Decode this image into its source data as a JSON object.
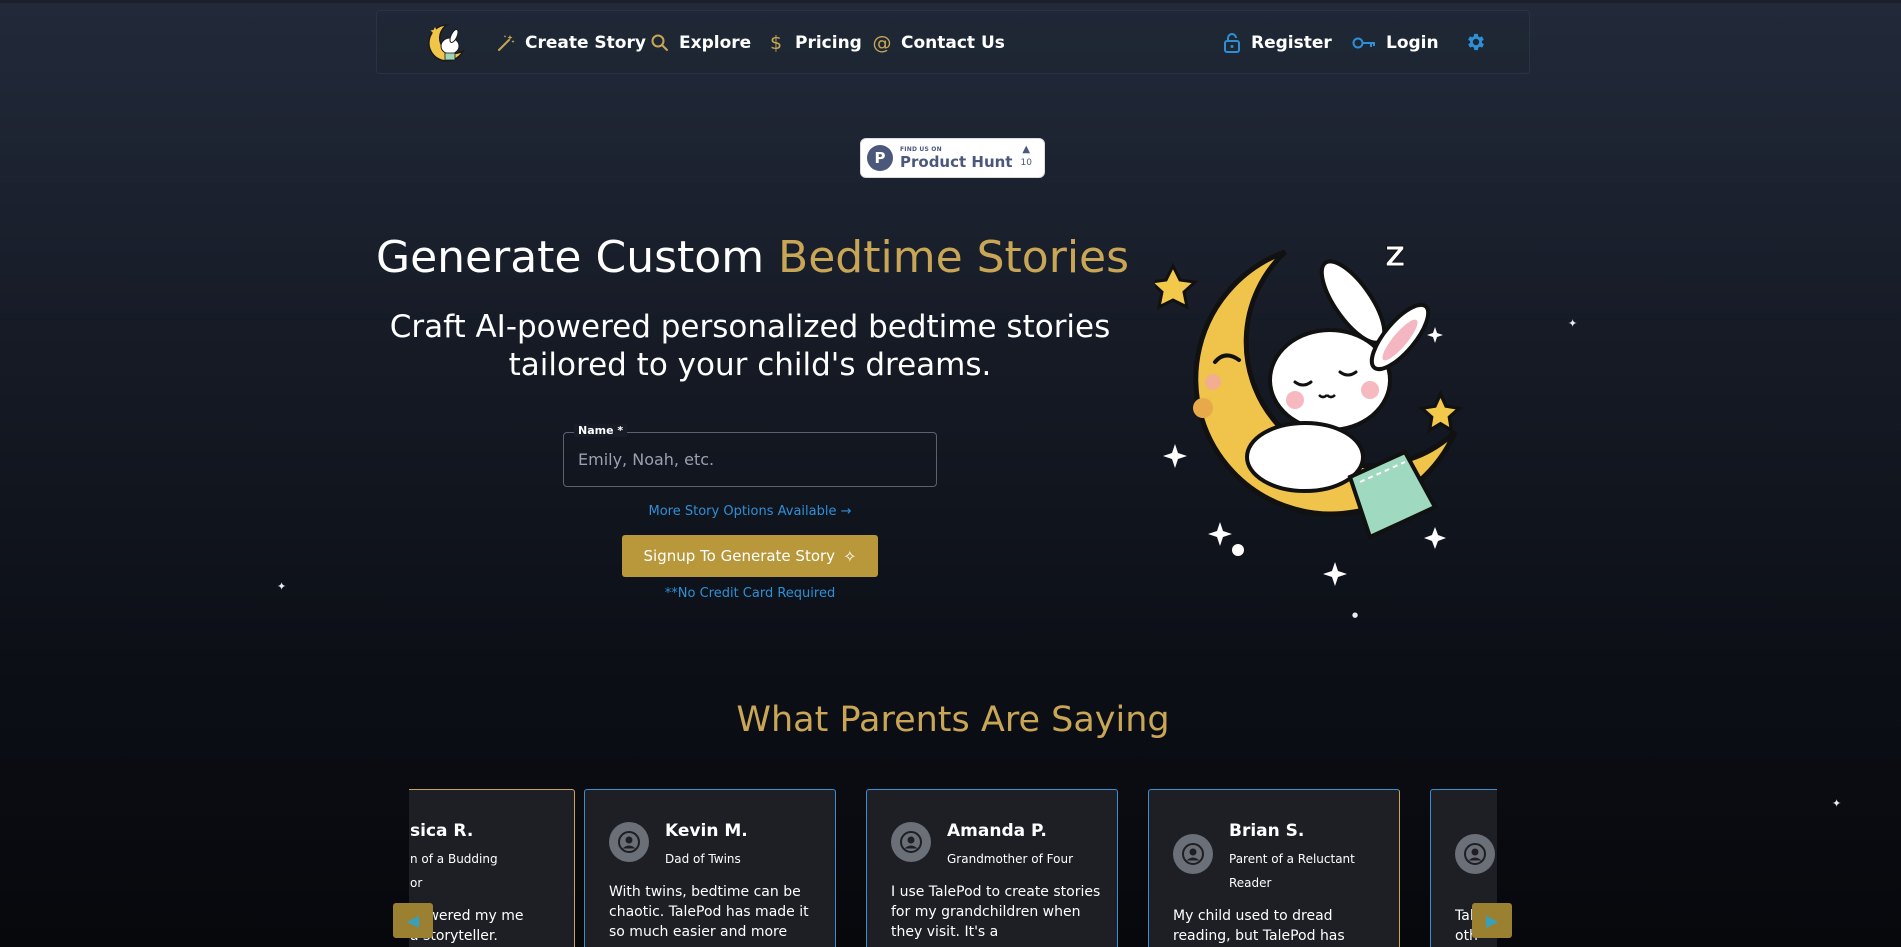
{
  "nav": {
    "items": [
      {
        "label": "Create Story",
        "icon": "magic-wand-icon"
      },
      {
        "label": "Explore",
        "icon": "search-icon"
      },
      {
        "label": "Pricing",
        "icon": "dollar-icon"
      },
      {
        "label": "Contact Us",
        "icon": "at-sign-icon"
      }
    ],
    "register": "Register",
    "login": "Login"
  },
  "product_hunt": {
    "small": "FIND US ON",
    "big": "Product Hunt",
    "letter": "P",
    "votes": "10"
  },
  "hero": {
    "title_main": "Generate Custom ",
    "title_accent": "Bedtime Stories",
    "subtitle": "Craft AI-powered personalized bedtime stories tailored to your child's dreams.",
    "name_label": "Name *",
    "name_placeholder": "Emily, Noah, etc.",
    "more_options": "More Story Options Available  →",
    "cta": "Signup To Generate Story",
    "no_cc": "**No Credit Card Required"
  },
  "testimonials": {
    "title": "What Parents Are Saying",
    "cards": [
      {
        "name": "sica R.",
        "role": "n of a Budding or",
        "quote": "powered my me a storyteller."
      },
      {
        "name": "Kevin M.",
        "role": "Dad of Twins",
        "quote": "With twins, bedtime can be chaotic. TalePod has made it so much easier and more"
      },
      {
        "name": "Amanda P.",
        "role": "Grandmother of Four",
        "quote": "I use TalePod to create stories for my grandchildren when they visit. It's a"
      },
      {
        "name": "Brian S.",
        "role": "Parent of a Reluctant Reader",
        "quote": "My child used to dread reading, but TalePod has"
      },
      {
        "name": "",
        "role": "",
        "quote": "Tal oth"
      }
    ]
  },
  "colors": {
    "accent_gold": "#c9a655",
    "button_gold": "#b8983a",
    "link_blue": "#2f8fd6"
  }
}
